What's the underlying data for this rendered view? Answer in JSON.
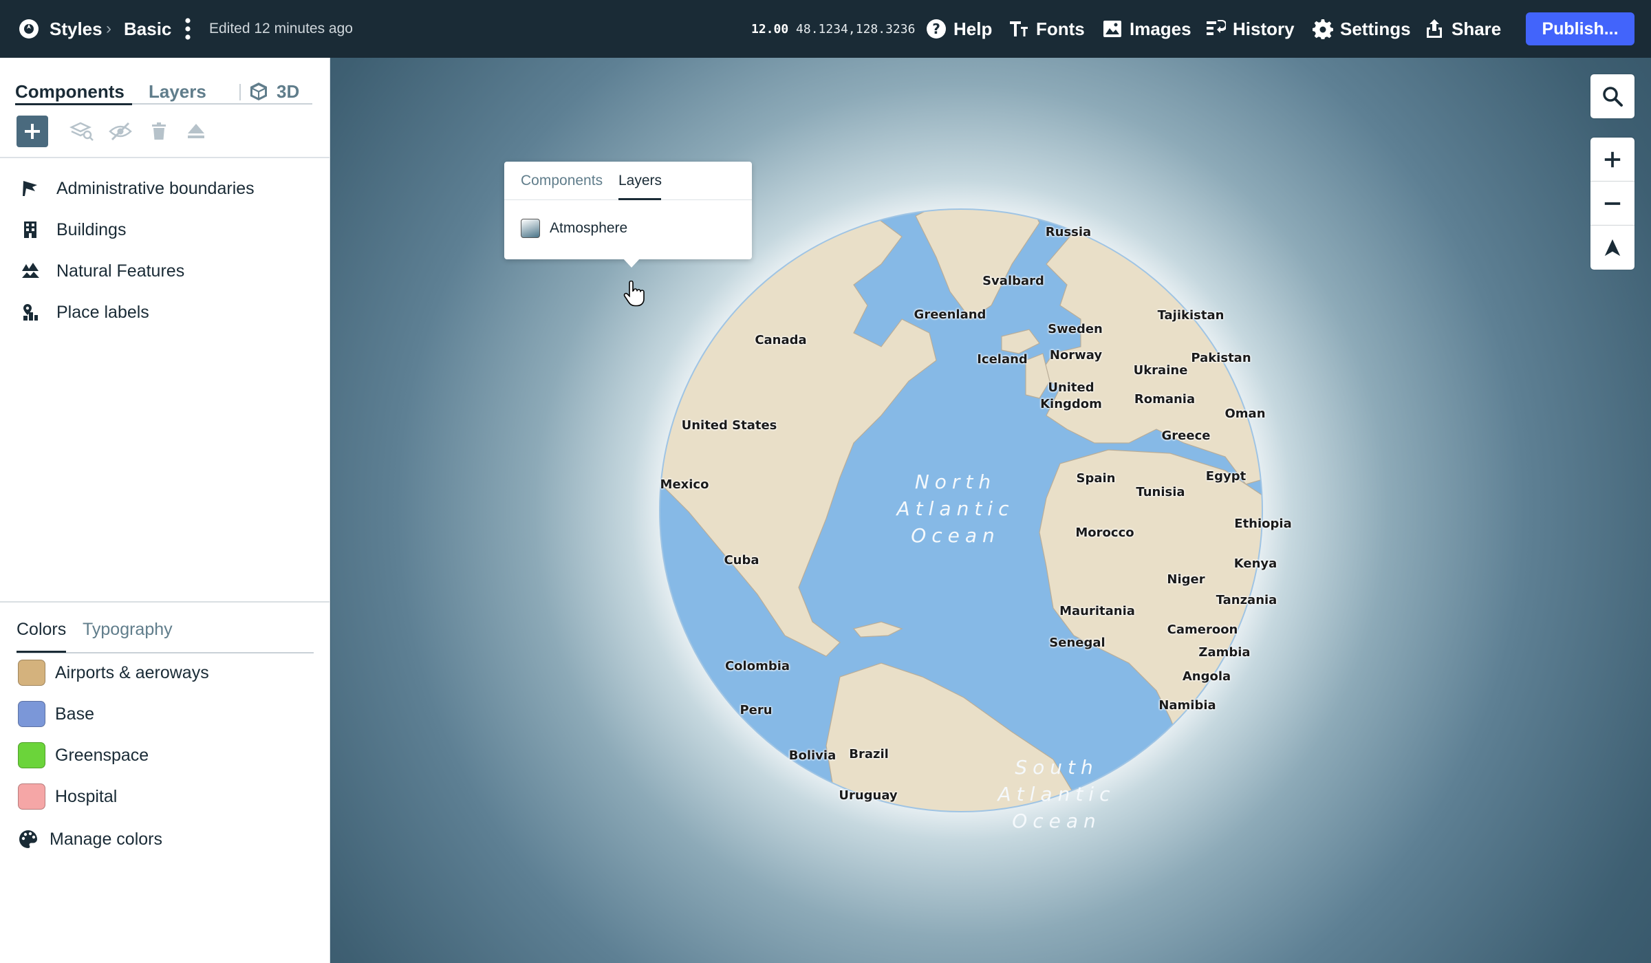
{
  "topbar": {
    "breadcrumb_root": "Styles",
    "breadcrumb_current": "Basic",
    "edited": "Edited 12 minutes ago",
    "zoom": "12.00",
    "coords": "48.1234,128.3236",
    "help": "Help",
    "fonts": "Fonts",
    "images": "Images",
    "history": "History",
    "settings": "Settings",
    "share": "Share",
    "publish": "Publish..."
  },
  "sidebar": {
    "tabs": {
      "components": "Components",
      "layers": "Layers",
      "three_d": "3D"
    },
    "components": [
      {
        "label": "Administrative boundaries",
        "icon": "flag-icon"
      },
      {
        "label": "Buildings",
        "icon": "building-icon"
      },
      {
        "label": "Natural Features",
        "icon": "trees-icon"
      },
      {
        "label": "Place labels",
        "icon": "place-label-icon"
      }
    ],
    "style_tabs": {
      "colors": "Colors",
      "typography": "Typography"
    },
    "colors": [
      {
        "label": "Airports & aeroways",
        "swatch": "#d4b27d"
      },
      {
        "label": "Base",
        "swatch": "#7b97d8"
      },
      {
        "label": "Greenspace",
        "swatch": "#6bd43a"
      },
      {
        "label": "Hospital",
        "swatch": "#f5a6a6"
      }
    ],
    "manage_colors": "Manage colors"
  },
  "popover": {
    "tab_components": "Components",
    "tab_layers": "Layers",
    "layer": "Atmosphere"
  },
  "map": {
    "ocean_color": "#86b9e6",
    "land_color": "#e9dfc8",
    "labels": {
      "russia": "Russia",
      "svalbard": "Svalbard",
      "greenland": "Greenland",
      "tajikistan": "Tajikistan",
      "canada": "Canada",
      "sweden": "Sweden",
      "pakistan": "Pakistan",
      "iceland": "Iceland",
      "norway": "Norway",
      "ukraine": "Ukraine",
      "united_kingdom_1": "United",
      "united_kingdom_2": "Kingdom",
      "romania": "Romania",
      "oman": "Oman",
      "united_states": "United States",
      "greece": "Greece",
      "spain": "Spain",
      "egypt": "Egypt",
      "mexico": "Mexico",
      "tunisia": "Tunisia",
      "ethiopia": "Ethiopia",
      "morocco": "Morocco",
      "cuba": "Cuba",
      "kenya": "Kenya",
      "niger": "Niger",
      "tanzania": "Tanzania",
      "mauritania": "Mauritania",
      "cameroon": "Cameroon",
      "senegal": "Senegal",
      "zambia": "Zambia",
      "colombia": "Colombia",
      "angola": "Angola",
      "namibia": "Namibia",
      "peru": "Peru",
      "bolivia": "Bolivia",
      "brazil": "Brazil",
      "uruguay": "Uruguay"
    },
    "north_atlantic": [
      "North",
      "Atlantic",
      "Ocean"
    ],
    "south_atlantic": [
      "South",
      "Atlantic",
      "Ocean"
    ]
  }
}
